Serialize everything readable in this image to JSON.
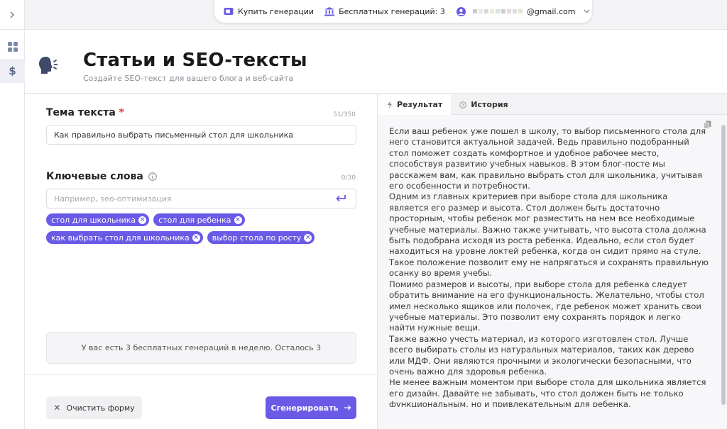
{
  "topbar": {
    "buy_label": "Купить генерации",
    "free_label": "Бесплатных генераций: 3",
    "email_suffix": "@gmail.com"
  },
  "page": {
    "title": "Статьи и SEO-тексты",
    "subtitle": "Создайте SEO-текст для вашего блога и веб-сайта"
  },
  "form": {
    "topic_label": "Тема текста",
    "topic_required": "*",
    "topic_counter": "51/350",
    "topic_value": "Как правильно выбрать письменный стол для школьника",
    "keywords_label": "Ключевые слова",
    "keywords_counter": "0/30",
    "keywords_placeholder": "Например, seo-оптимизация",
    "tags": [
      "стол для школьника",
      "стол для ребенка",
      "как выбрать стол для школьника",
      "выбор стола по росту"
    ],
    "notice": "У вас есть 3 бесплатных генераций в неделю. Осталось 3",
    "clear_label": "Очистить форму",
    "generate_label": "Сгенерировать"
  },
  "tabs": {
    "result": "Результат",
    "history": "История"
  },
  "result_paragraphs": [
    "Если ваш ребенок уже пошел в школу, то выбор письменного стола для него становится актуальной задачей. Ведь правильно подобранный стол поможет создать комфортное и удобное рабочее место, способствуя развитию учебных навыков. В этом блог-посте мы расскажем вам, как правильно выбрать стол для школьника, учитывая его особенности и потребности.",
    "Одним из главных критериев при выборе стола для школьника является его размер и высота. Стол должен быть достаточно просторным, чтобы ребенок мог разместить на нем все необходимые учебные материалы. Важно также учитывать, что высота стола должна быть подобрана исходя из роста ребенка. Идеально, если стол будет находиться на уровне локтей ребенка, когда он сидит прямо на стуле. Такое положение позволит ему не напрягаться и сохранять правильную осанку во время учебы.",
    "Помимо размеров и высоты, при выборе стола для ребенка следует обратить внимание на его функциональность. Желательно, чтобы стол имел несколько ящиков или полочек, где ребенок может хранить свои учебные материалы. Это позволит ему сохранять порядок и легко найти нужные вещи.",
    "Также важно учесть материал, из которого изготовлен стол. Лучше всего выбирать столы из натуральных материалов, таких как дерево или МДФ. Они являются прочными и экологически безопасными, что очень важно для здоровья ребенка.",
    "Не менее важным моментом при выборе стола для школьника является его дизайн. Давайте не забывать, что стол должен быть не только функциональным, но и привлекательным для ребенка."
  ],
  "colors": {
    "accent": "#6a5ae6",
    "required": "#e53935"
  }
}
